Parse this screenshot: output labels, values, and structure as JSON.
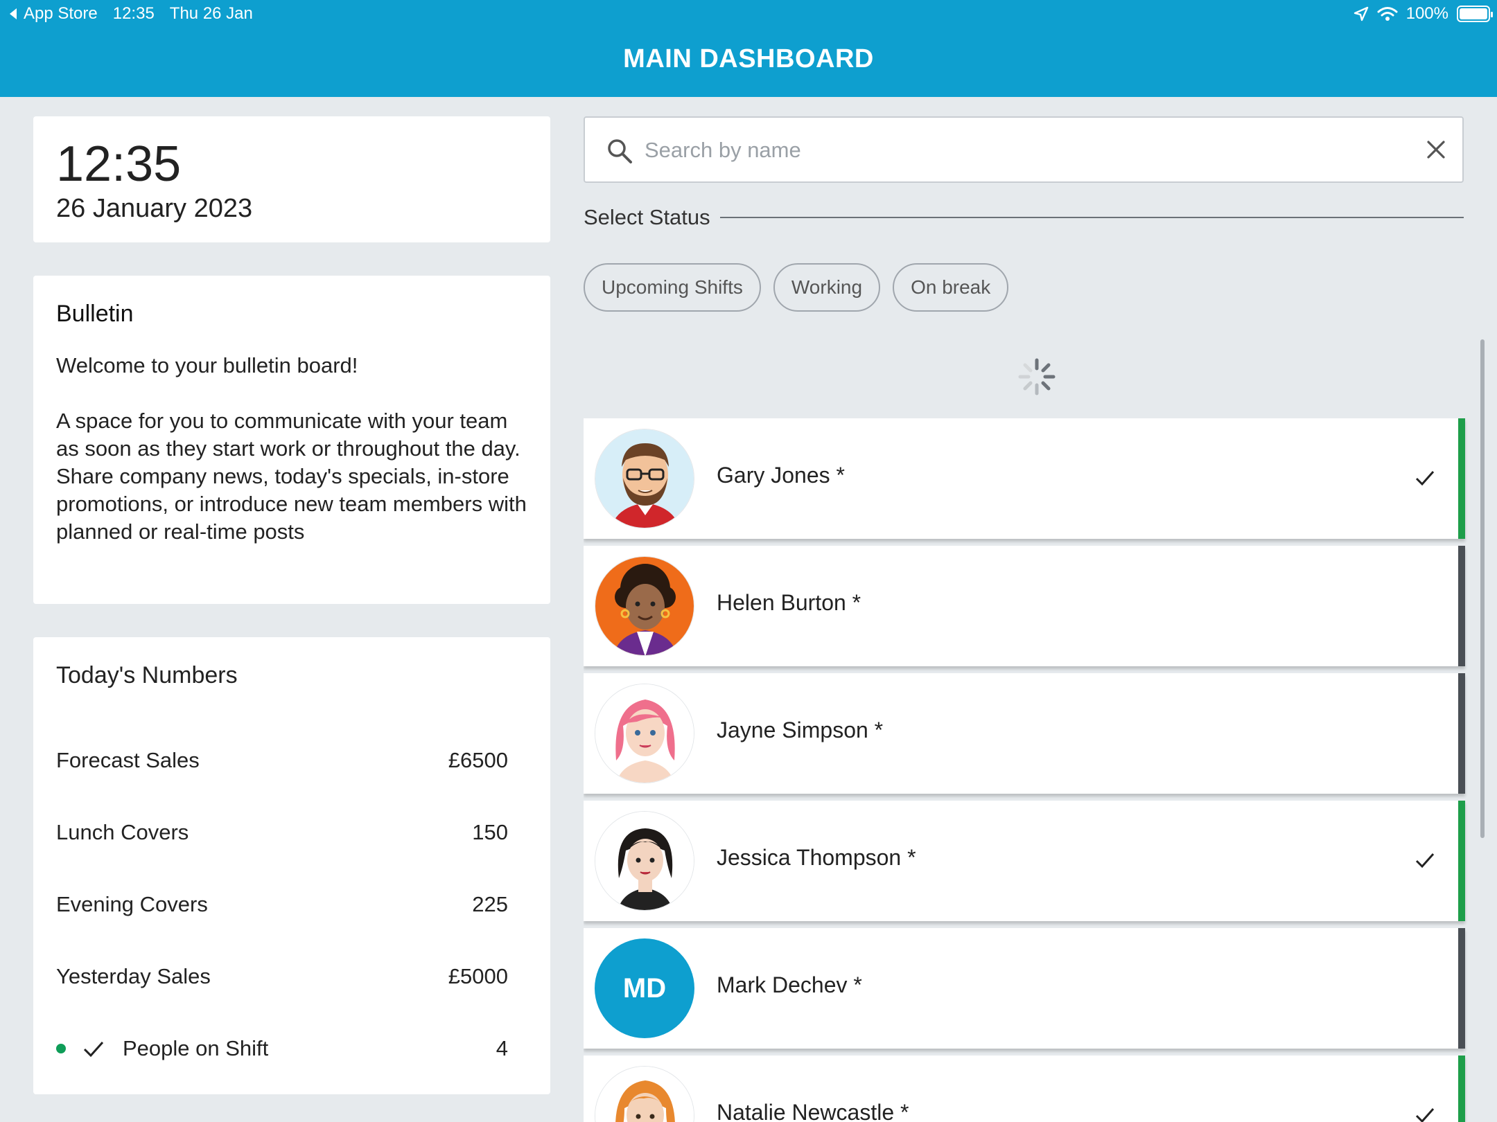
{
  "status_bar": {
    "back_label": "App Store",
    "time": "12:35",
    "date": "Thu 26 Jan",
    "battery": "100%",
    "battery_level": 1.0
  },
  "header": {
    "title": "MAIN DASHBOARD"
  },
  "clock": {
    "time": "12:35",
    "date": "26 January 2023"
  },
  "bulletin": {
    "title": "Bulletin",
    "greeting": "Welcome to your bulletin board!",
    "body": "A space for you to communicate with your team as soon as they start work or throughout the day. Share company news, today's specials, in-store promotions, or introduce new team members with planned or real-time posts"
  },
  "numbers": {
    "title": "Today's Numbers",
    "rows": [
      {
        "label": "Forecast Sales",
        "value": "£6500"
      },
      {
        "label": "Lunch Covers",
        "value": "150"
      },
      {
        "label": "Evening Covers",
        "value": "225"
      },
      {
        "label": "Yesterday Sales",
        "value": "£5000"
      },
      {
        "label": "People on Shift",
        "value": "4"
      }
    ]
  },
  "search": {
    "placeholder": "Search by name",
    "value": ""
  },
  "status_filter": {
    "label": "Select Status",
    "chips": [
      "Upcoming Shifts",
      "Working",
      "On break"
    ]
  },
  "people": [
    {
      "name": "Gary Jones *",
      "checked": true,
      "status_color": "#1e9e4a",
      "avatar": "man-with-glasses-and-beard"
    },
    {
      "name": "Helen Burton *",
      "checked": false,
      "status_color": "#4a4f55",
      "avatar": "woman-curly-hair-orange-bg"
    },
    {
      "name": "Jayne Simpson *",
      "checked": false,
      "status_color": "#4a4f55",
      "avatar": "woman-pink-hair"
    },
    {
      "name": "Jessica Thompson *",
      "checked": true,
      "status_color": "#1e9e4a",
      "avatar": "woman-black-bob"
    },
    {
      "name": "Mark Dechev *",
      "checked": false,
      "status_color": "#4a4f55",
      "initials": "MD"
    },
    {
      "name": "Natalie Newcastle *",
      "checked": true,
      "status_color": "#1e9e4a",
      "avatar": "woman-ginger-hair"
    }
  ],
  "colors": {
    "brand": "#0e9fcf",
    "working": "#1e9e4a",
    "off": "#4a4f55"
  }
}
